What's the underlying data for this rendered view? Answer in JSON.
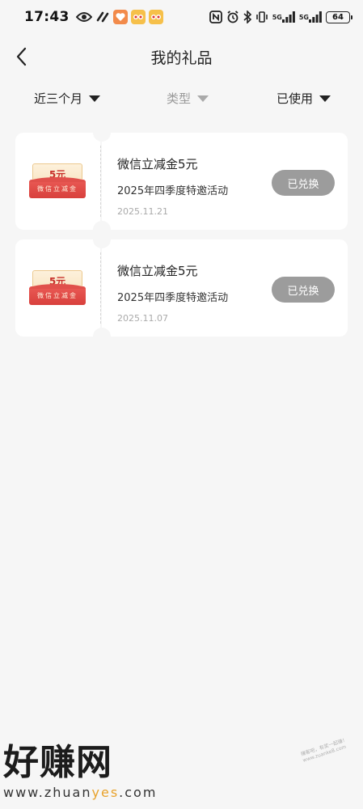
{
  "status_bar": {
    "time": "17:43",
    "network_left": "5G",
    "network_right": "5G",
    "battery": "64"
  },
  "header": {
    "title": "我的礼品",
    "back_icon": "chevron-left-icon"
  },
  "filters": [
    {
      "label": "近三个月",
      "state": "active"
    },
    {
      "label": "类型",
      "state": "disabled"
    },
    {
      "label": "已使用",
      "state": "active"
    }
  ],
  "gifts": [
    {
      "icon_amount": "5元",
      "icon_label": "微信立减金",
      "title": "微信立减金5元",
      "subtitle": "2025年四季度特邀活动",
      "date": "2025.11.21",
      "button": "已兑换"
    },
    {
      "icon_amount": "5元",
      "icon_label": "微信立减金",
      "title": "微信立减金5元",
      "subtitle": "2025年四季度特邀活动",
      "date": "2025.11.07",
      "button": "已兑换"
    }
  ],
  "watermark": {
    "logo": "好赚网",
    "url_prefix": "www.zhuan",
    "url_highlight": "yes",
    "url_suffix": ".com",
    "small_text": "赚客吧，有奖一起赚！ www.zuanke8.com"
  },
  "colors": {
    "background": "#f6f6f6",
    "button_grey": "#9c9c9c",
    "coupon_red": "#d8403c"
  }
}
